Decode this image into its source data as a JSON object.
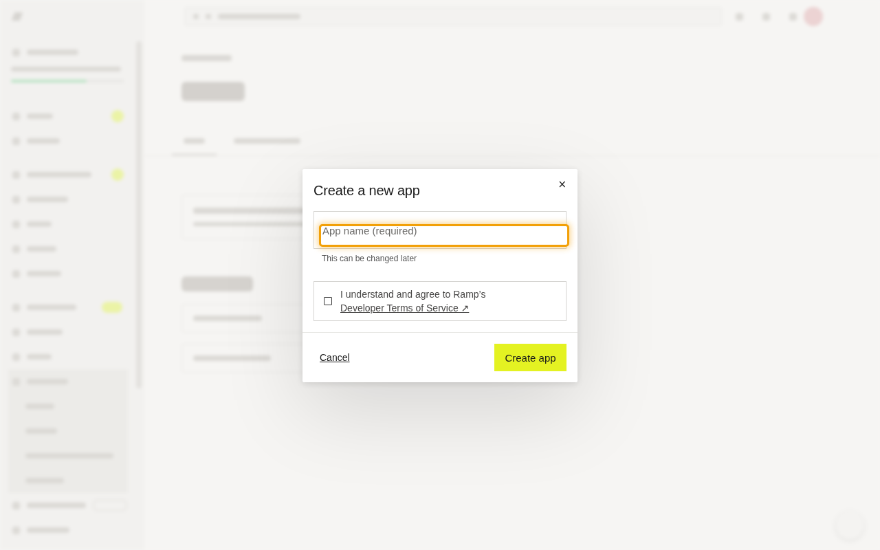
{
  "dialog": {
    "title": "Create a new app",
    "close": "×",
    "name_field": {
      "placeholder": "App name (required)",
      "focused": true,
      "hint": "This can be changed later"
    },
    "agreement": {
      "checked": false,
      "text": "I understand and agree to Ramp’s ",
      "link": "Developer Terms of Service ↗"
    },
    "cancel": "Cancel",
    "submit": "Create app"
  }
}
